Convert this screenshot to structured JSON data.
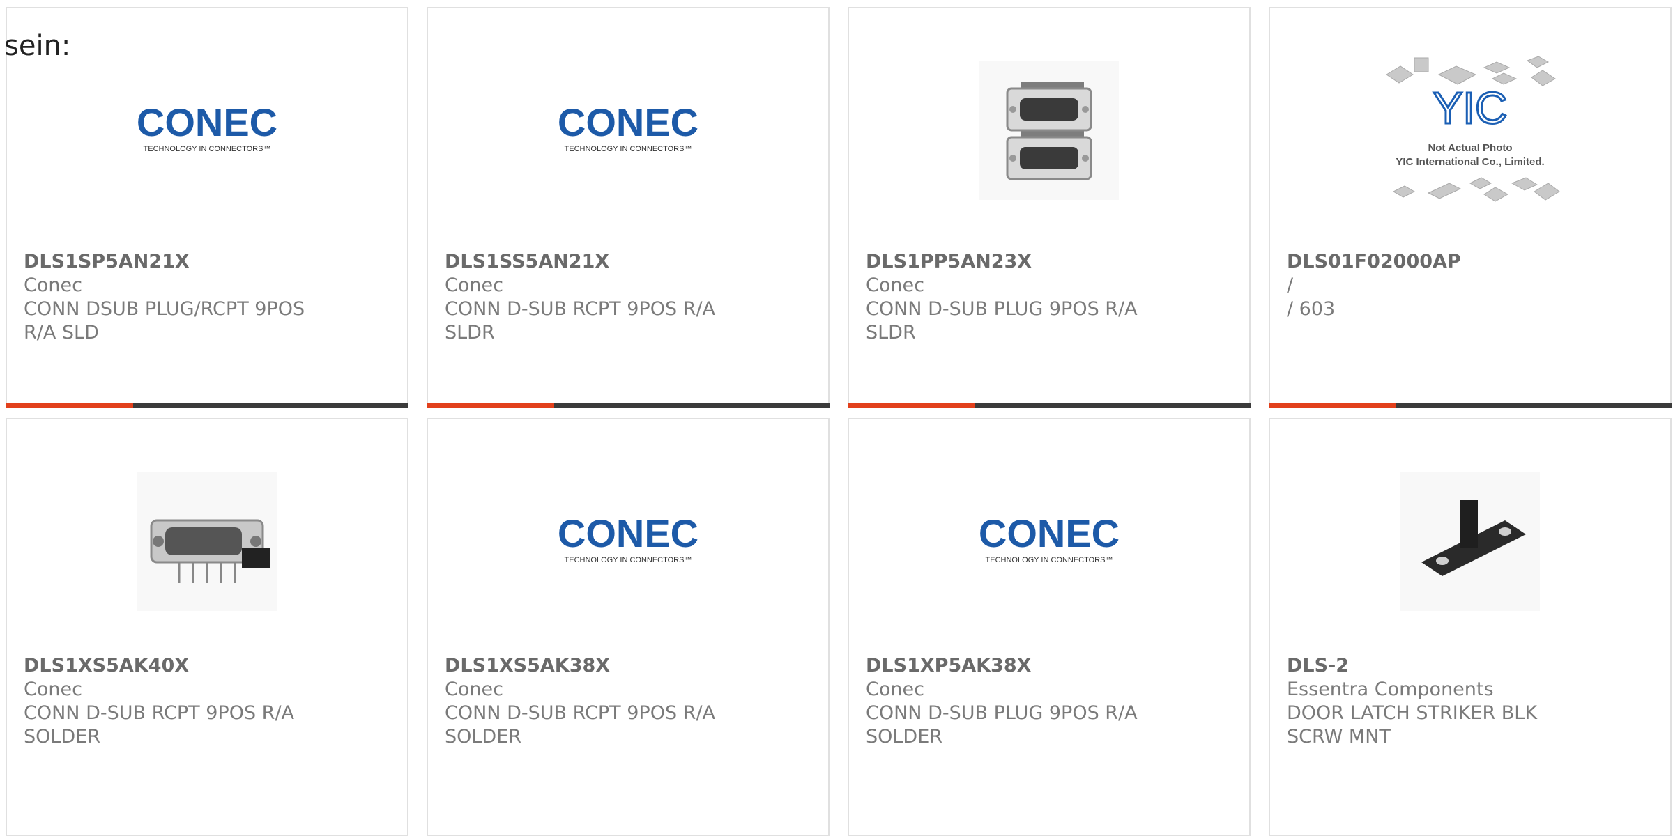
{
  "intro_text": "sein:",
  "colors": {
    "accent": "#e2401c",
    "bar": "#3b3b3b",
    "conec_blue": "#1d5aa8",
    "yic_blue": "#1b5fb4"
  },
  "cards": [
    {
      "part_number": "DLS1SP5AN21X",
      "lines": [
        "Conec",
        "CONN DSUB PLUG/RCPT 9POS",
        "R/A SLD"
      ],
      "image": "conec-logo"
    },
    {
      "part_number": "DLS1SS5AN21X",
      "lines": [
        "Conec",
        "CONN D-SUB RCPT 9POS R/A",
        "SLDR"
      ],
      "image": "conec-logo"
    },
    {
      "part_number": "DLS1PP5AN23X",
      "lines": [
        "Conec",
        "CONN D-SUB PLUG 9POS R/A",
        "SLDR"
      ],
      "image": "stacked-dsub-photo"
    },
    {
      "part_number": "DLS01F02000AP",
      "lines": [
        "/",
        "/ 603"
      ],
      "image": "yic-placeholder",
      "yic_caption_1": "Not Actual Photo",
      "yic_caption_2": "YIC International Co., Limited."
    },
    {
      "part_number": "DLS1XS5AK40X",
      "lines": [
        "Conec",
        "CONN D-SUB RCPT 9POS R/A",
        "SOLDER"
      ],
      "image": "dsub-receptacle-photo"
    },
    {
      "part_number": "DLS1XS5AK38X",
      "lines": [
        "Conec",
        "CONN D-SUB RCPT 9POS R/A",
        "SOLDER"
      ],
      "image": "conec-logo"
    },
    {
      "part_number": "DLS1XP5AK38X",
      "lines": [
        "Conec",
        "CONN D-SUB PLUG 9POS R/A",
        "SOLDER"
      ],
      "image": "conec-logo"
    },
    {
      "part_number": "DLS-2",
      "lines": [
        "Essentra Components",
        "DOOR LATCH STRIKER BLK",
        "SCRW MNT"
      ],
      "image": "latch-striker-photo"
    }
  ],
  "conec_logo": {
    "wordmark": "CONEC",
    "tagline": "TECHNOLOGY IN CONNECTORS™"
  }
}
